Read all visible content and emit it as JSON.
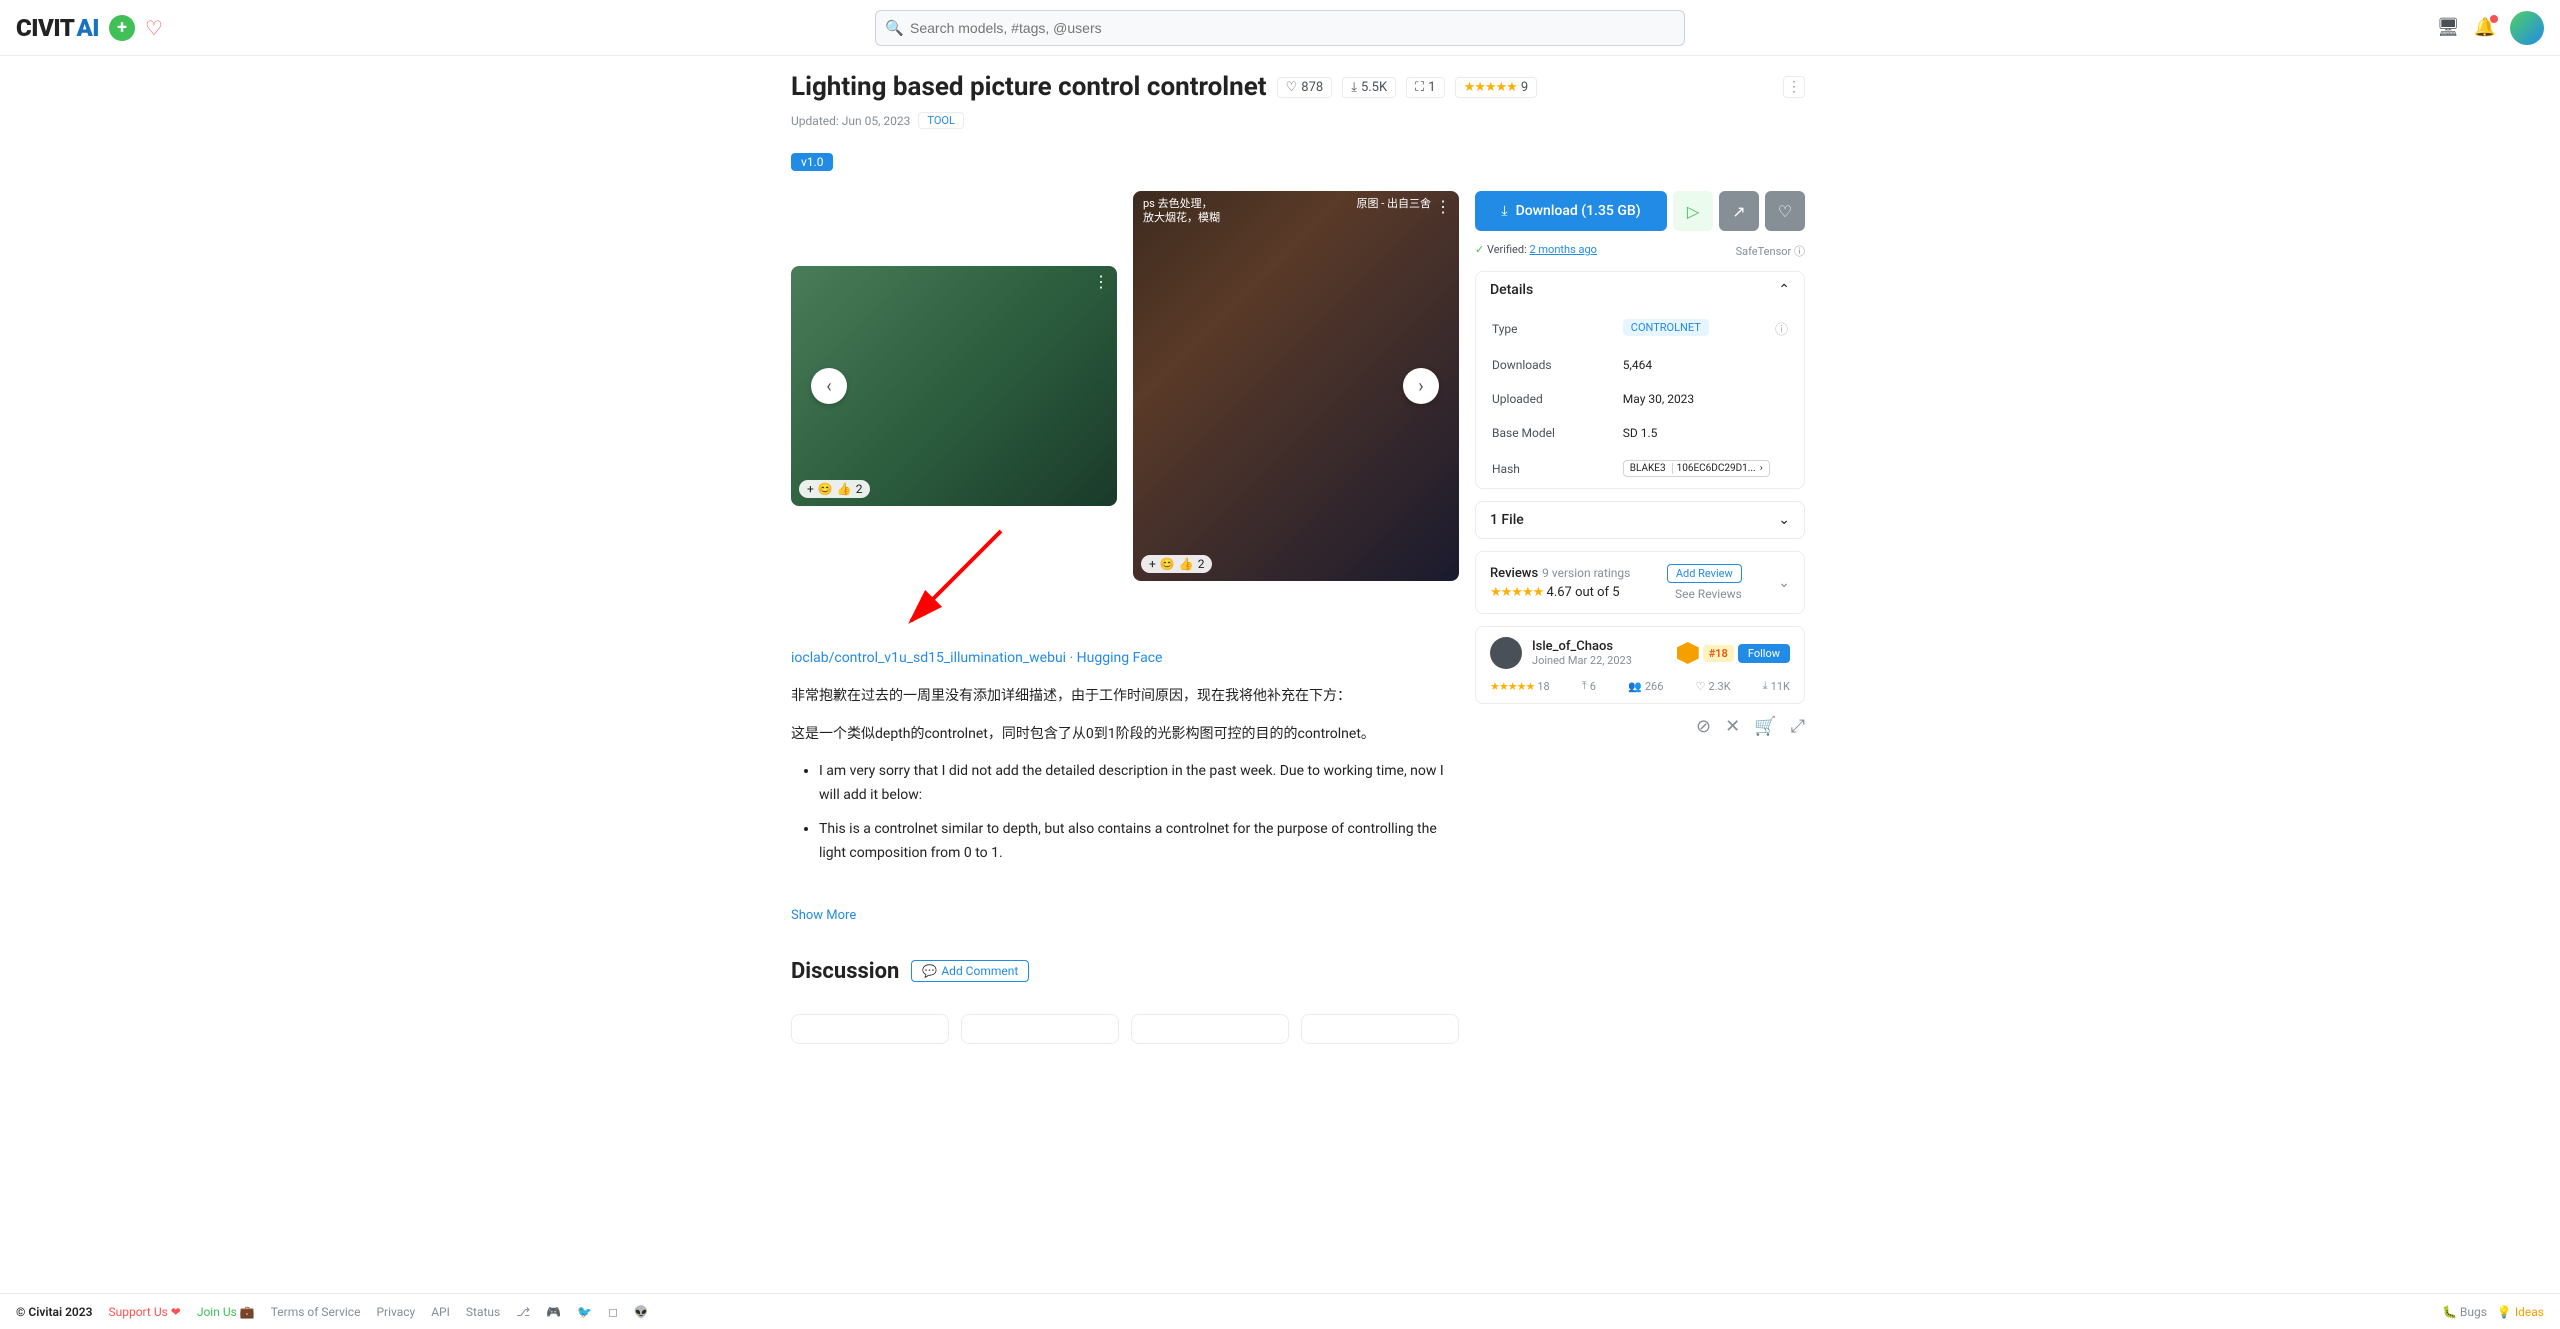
{
  "header": {
    "logo_pre": "CIVIT",
    "logo_post": "AI",
    "search_placeholder": "Search models, #tags, @users"
  },
  "title": "Lighting based picture control controlnet",
  "stats": {
    "likes": "878",
    "downloads": "5.5K",
    "reviews_icon_count": "1",
    "rating_count": "9"
  },
  "meta": {
    "updated": "Updated: Jun 05, 2023",
    "tool": "TOOL"
  },
  "version": "v1.0",
  "gallery": {
    "caption_b_line1": "ps 去色处理，",
    "caption_b_line2": "放大烟花，模糊",
    "caption_b_right": "原图 - 出自三舍",
    "react_a": "2",
    "react_b": "2"
  },
  "download": {
    "label": "Download (1.35 GB)",
    "verified_label": "Verified:",
    "verified_when": "2 months ago",
    "safe": "SafeTensor"
  },
  "details": {
    "header": "Details",
    "rows": {
      "type": "Type",
      "type_v": "CONTROLNET",
      "dl": "Downloads",
      "dl_v": "5,464",
      "up": "Uploaded",
      "up_v": "May 30, 2023",
      "bm": "Base Model",
      "bm_v": "SD 1.5",
      "hash": "Hash",
      "hash_alg": "BLAKE3",
      "hash_v": "106EC6DC29D1..."
    }
  },
  "files": {
    "header": "1 File"
  },
  "reviews": {
    "label": "Reviews",
    "sub": "9 version ratings",
    "score": "4.67 out of 5",
    "add": "Add Review",
    "see": "See Reviews"
  },
  "author": {
    "name": "Isle_of_Chaos",
    "joined": "Joined Mar 22, 2023",
    "rank": "#18",
    "follow": "Follow",
    "stars_count": "18",
    "s1": "6",
    "s2": "266",
    "s3": "2.3K",
    "s4": "11K"
  },
  "desc": {
    "link": "ioclab/control_v1u_sd15_illumination_webui · Hugging Face",
    "p1": "非常抱歉在过去的一周里没有添加详细描述，由于工作时间原因，现在我将他补充在下方：",
    "p2": "这是一个类似depth的controlnet，同时包含了从0到1阶段的光影构图可控的目的的controlnet。",
    "li1": "I am very sorry that I did not add the detailed description in the past week. Due to working time, now I will add it below:",
    "li2": "This is a controlnet similar to depth, but also contains a controlnet for the purpose of controlling the light composition from 0 to 1.",
    "show_more": "Show More"
  },
  "discussion": {
    "title": "Discussion",
    "add": "Add Comment"
  },
  "footer": {
    "copyright": "© Civitai 2023",
    "support": "Support Us",
    "join": "Join Us",
    "tos": "Terms of Service",
    "privacy": "Privacy",
    "api": "API",
    "status": "Status",
    "bugs": "🐛 Bugs",
    "ideas": "Ideas"
  }
}
